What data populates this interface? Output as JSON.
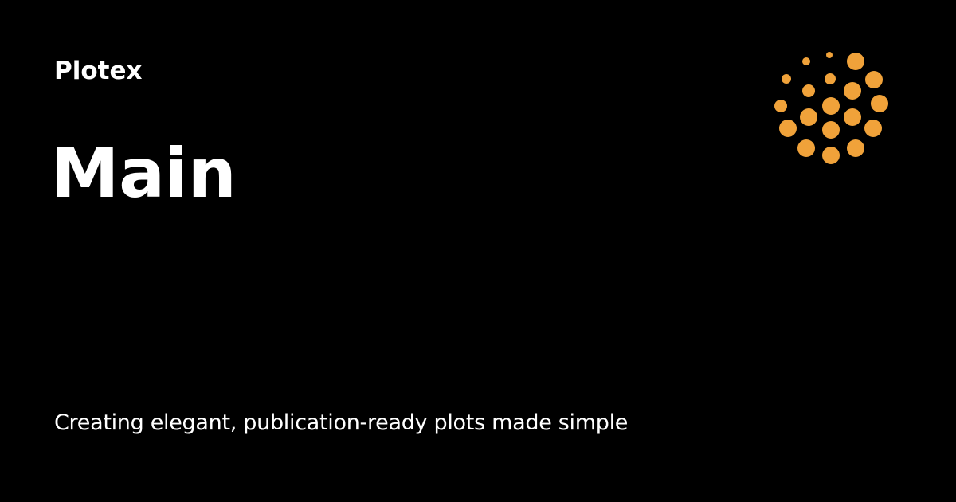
{
  "brand": {
    "name": "Plotex",
    "accent_color": "#f0a23a"
  },
  "page": {
    "title": "Main",
    "tagline": "Creating elegant, publication-ready plots made simple"
  },
  "logo": {
    "icon": "dot-sunburst-icon"
  }
}
